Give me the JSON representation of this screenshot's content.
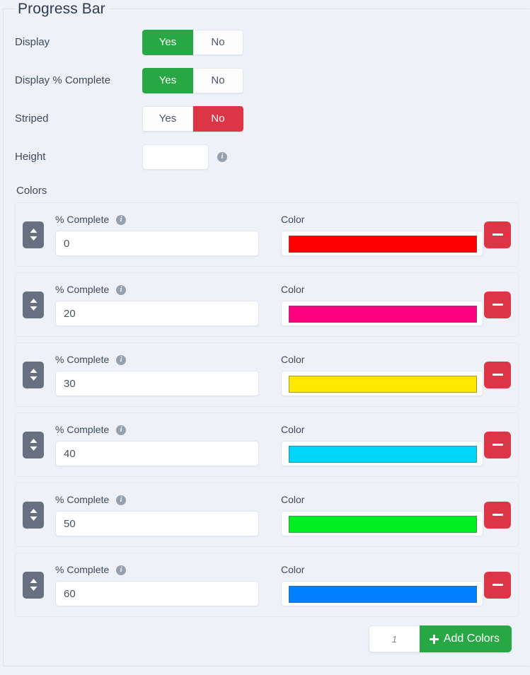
{
  "fieldset": {
    "legend": "Progress Bar"
  },
  "settings": [
    {
      "label": "Display",
      "options": [
        "Yes",
        "No"
      ],
      "selected": "Yes"
    },
    {
      "label": "Display % Complete",
      "options": [
        "Yes",
        "No"
      ],
      "selected": "Yes"
    },
    {
      "label": "Striped",
      "options": [
        "Yes",
        "No"
      ],
      "selected": "No"
    }
  ],
  "height_field": {
    "label": "Height",
    "value": "",
    "placeholder": "",
    "info_icon": "info-circle-icon"
  },
  "colors_section": {
    "label": "Colors",
    "pct_label": "% Complete",
    "color_label": "Color",
    "info_icon": "info-circle-icon",
    "drag_icon": "sort-updown-icon",
    "remove_icon": "minus-icon",
    "rows": [
      {
        "pct": "0",
        "color": "#FF0000"
      },
      {
        "pct": "20",
        "color": "#FF0080"
      },
      {
        "pct": "30",
        "color": "#FFE800"
      },
      {
        "pct": "40",
        "color": "#00D5FA"
      },
      {
        "pct": "50",
        "color": "#00F021"
      },
      {
        "pct": "60",
        "color": "#0080FF"
      }
    ]
  },
  "footer": {
    "count_value": "1",
    "count_placeholder": "1",
    "add_label": "Add Colors",
    "add_icon": "plus-icon"
  },
  "theme": {
    "page_bg": "#eef1f8",
    "accent_green": "#28a745",
    "accent_red": "#dc3545",
    "text": "#3d4a5c",
    "handle_gray": "#667080"
  }
}
